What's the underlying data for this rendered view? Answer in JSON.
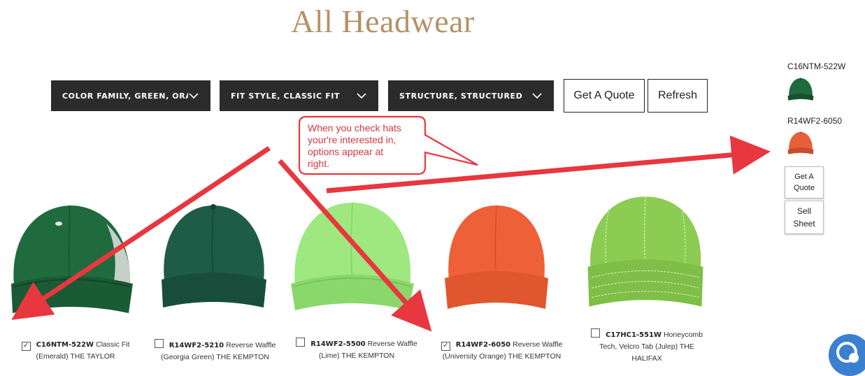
{
  "page": {
    "title": "All Headwear"
  },
  "filters": [
    {
      "label": "COLOR FAMILY, GREEN, ORA..."
    },
    {
      "label": "FIT STYLE, CLASSIC FIT"
    },
    {
      "label": "STRUCTURE, STRUCTURED"
    }
  ],
  "actions": {
    "quote_label": "Get A Quote",
    "refresh_label": "Refresh"
  },
  "sidebar": {
    "items": [
      {
        "code": "C16NTM-522W",
        "color": "#1f6b3e"
      },
      {
        "code": "R14WF2-6050",
        "color": "#e8603a"
      }
    ],
    "quote_line1": "Get A",
    "quote_line2": "Quote",
    "sell_line1": "Sell",
    "sell_line2": "Sheet"
  },
  "annotation": {
    "line1": "When you check hats",
    "line2": "your're interested in,",
    "line3": "options appear at",
    "line4": "right.",
    "color": "#e8373f"
  },
  "products": [
    {
      "code": "C16NTM-522W",
      "name_a": "Classic Fit",
      "name_b": "(Emerald)  THE TAYLOR",
      "checked": true,
      "check_mark": "✓",
      "color": "#1f6b3e"
    },
    {
      "code": "R14WF2-5210",
      "name_a": "Reverse Waffle",
      "name_b": "(Georgia Green)  THE KEMPTON",
      "checked": false,
      "check_mark": "",
      "color": "#1e5c47"
    },
    {
      "code": "R14WF2-5500",
      "name_a": "Reverse Waffle",
      "name_b": "(Lime)  THE KEMPTON",
      "checked": false,
      "check_mark": "",
      "color": "#9ee87f"
    },
    {
      "code": "R14WF2-6050",
      "name_a": "Reverse Waffle",
      "name_b": "(University Orange)  THE KEMPTON",
      "checked": true,
      "check_mark": "✓",
      "color": "#ee6038"
    },
    {
      "code": "C17HC1-551W",
      "name_a": "Honeycomb",
      "name_b": "Tech, Velcro Tab (Julep)  THE",
      "name_c": "HALIFAX",
      "checked": false,
      "check_mark": "",
      "color": "#8ccc52"
    }
  ]
}
